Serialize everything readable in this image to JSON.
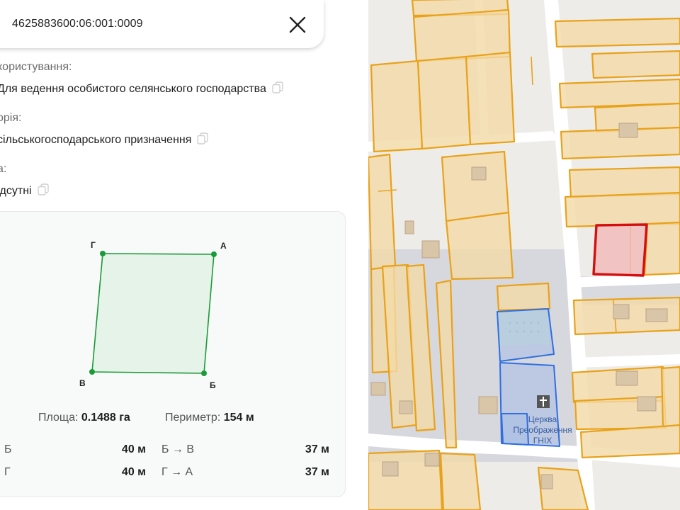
{
  "search": {
    "cadastral_number": "4625883600:06:001:0009"
  },
  "parcel_info": {
    "usage_label": "користування:",
    "usage_value": "Для ведення особистого селянського господарства",
    "category_label": "орія:",
    "category_value": "сільськогосподарського призначення",
    "third_label": "а:",
    "third_value": "ідсутні"
  },
  "shape": {
    "vertices": {
      "a": "А",
      "b": "Б",
      "v": "В",
      "g": "Г"
    },
    "area_label": "Площа:",
    "area_value": "0.1488 га",
    "perimeter_label": "Периметр:",
    "perimeter_value": "154 м",
    "segments": [
      {
        "from_to": "Б",
        "length": "40 м"
      },
      {
        "from_to": "Б → В",
        "length": "37 м"
      },
      {
        "from_to": "Г",
        "length": "40 м"
      },
      {
        "from_to": "Г → А",
        "length": "37 м"
      }
    ]
  },
  "map": {
    "poi_church_line1": "Церква",
    "poi_church_line2": "Преображення",
    "poi_church_line3": "ГНІХ",
    "colors": {
      "parcel_outline": "#e8a21a",
      "parcel_fill": "#f3d9a6",
      "selected_parcel": "#d40f0f",
      "church_parcel": "#2f6fe0",
      "shape_green": "#1a9a38"
    }
  },
  "icons": {
    "close": "close-icon",
    "copy": "copy-icon",
    "church": "church-cross-icon"
  }
}
